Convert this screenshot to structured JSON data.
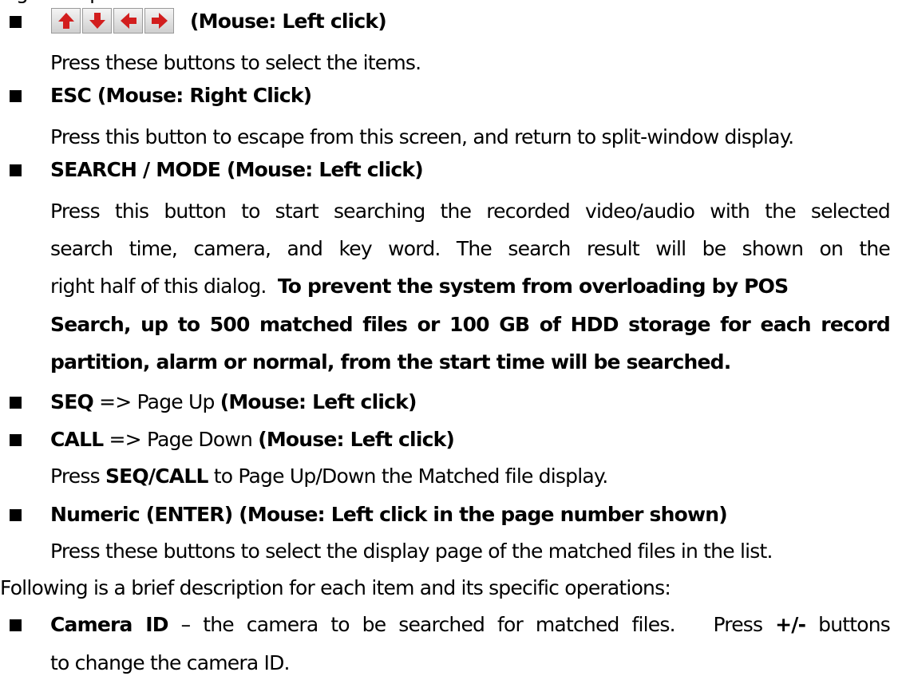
{
  "top_fragment": "given operations",
  "arrow_keys": {
    "icons": [
      "up-arrow-icon",
      "down-arrow-icon",
      "left-arrow-icon",
      "right-arrow-icon"
    ],
    "color": "#d21e1e",
    "mouse": "(Mouse: Left click)",
    "desc": "Press these buttons to select the items."
  },
  "esc": {
    "title": "ESC (Mouse: Right Click)",
    "desc": "Press this button to escape from this screen, and return to split-window display."
  },
  "search_mode": {
    "title": "SEARCH / MODE (Mouse: Left click)",
    "line1": "Press this button to start searching the recorded video/audio with the selected",
    "line2": "search time, camera, and key word.   The search result will be shown on the",
    "line3_plain": "right half of this dialog.  ",
    "line3_bold": "To prevent the system from overloading by POS",
    "line4": "Search, up to 500 matched files or 100 GB of HDD storage for each record",
    "line5": "partition, alarm or normal, from the start time will be searched."
  },
  "seq": {
    "key": "SEQ",
    "rest": " => Page Up ",
    "mouse": "(Mouse: Left click)"
  },
  "call": {
    "key": "CALL",
    "rest": " => Page Down ",
    "mouse": "(Mouse: Left click)"
  },
  "seqcall_desc": {
    "pre": "Press ",
    "key": "SEQ/CALL",
    "post": " to Page Up/Down the Matched file display."
  },
  "numeric": {
    "title": "Numeric (ENTER) (Mouse: Left click in the page number shown)",
    "desc": "Press these buttons to select the display page of the matched files in the list."
  },
  "following": "Following is a brief description for each item and its specific operations:",
  "camera_id": {
    "term": "Camera ID",
    "text1": " – the camera to be searched for matched files.   Press ",
    "plusminus": "+/-",
    "text2": " buttons",
    "line2": "to change the camera ID."
  }
}
